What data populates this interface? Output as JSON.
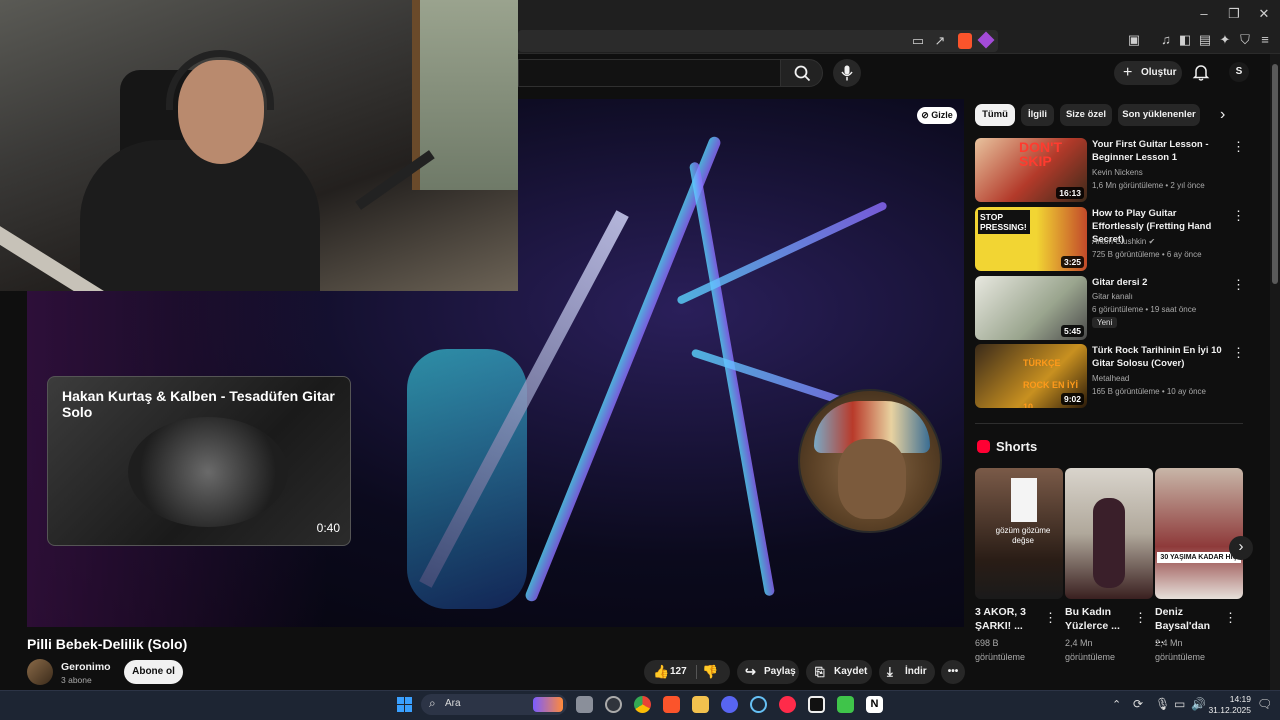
{
  "header": {
    "create_label": "Oluştur",
    "account_initial": "S"
  },
  "video": {
    "hide_label": "Gizle",
    "title": "Pilli Bebek-Delilik (Solo)",
    "channel": "Geronimo",
    "subs": "3 abone",
    "subscribe": "Abone ol",
    "likes": "127",
    "share": "Paylaş",
    "save": "Kaydet",
    "download": "İndir"
  },
  "minicard": {
    "title": "Hakan Kurtaş & Kalben - Tesadüfen Gitar Solo",
    "duration": "0:40"
  },
  "chips": [
    "Tümü",
    "İlgili",
    "Size özel",
    "Son yüklenenler"
  ],
  "recommendations": [
    {
      "title": "Your First Guitar Lesson - Beginner Lesson 1",
      "channel": "Kevin Nickens",
      "meta": "1,6 Mn görüntüleme • 2 yıl önce",
      "duration": "16:13",
      "thumb_text": "DON'T SKIP"
    },
    {
      "title": "How to Play Guitar Effortlessly (Fretting Hand Secret)",
      "channel": "Anton Glushkin",
      "meta": "725 B görüntüleme • 6 ay önce",
      "duration": "3:25",
      "thumb_text": "STOP PRESSING!"
    },
    {
      "title": "Gitar dersi 2",
      "channel": "Gitar kanalı",
      "meta": "6 görüntüleme • 19 saat önce",
      "duration": "5:45",
      "badge": "Yeni"
    },
    {
      "title": "Türk Rock Tarihinin En İyi 10 Gitar Solosu (Cover)",
      "channel": "Metalhead",
      "meta": "165 B görüntüleme • 10 ay önce",
      "duration": "9:02",
      "thumb_text": "TÜRKÇE ROCK EN İYİ 10"
    }
  ],
  "shorts": {
    "heading": "Shorts",
    "items": [
      {
        "title": "3 AKOR, 3 ŞARKI! ...",
        "views": "698 B",
        "views_label": "görüntüleme",
        "thumb_text": "gözüm gözüme değse"
      },
      {
        "title": "Bu Kadın Yüzlerce ...",
        "views": "2,4 Mn",
        "views_label": "görüntüleme"
      },
      {
        "title": "Deniz Baysal'dan ...",
        "views": "2,4 Mn",
        "views_label": "görüntüleme",
        "thumb_text": "30 YAŞIMA KADAR HİÇ"
      }
    ]
  },
  "taskbar": {
    "search_placeholder": "Ara",
    "time": "14:19",
    "date": "31.12.2025"
  },
  "colors": {
    "accent": "#ff0033",
    "bg": "#0f0f0f",
    "taskbar": "#1d2533"
  }
}
